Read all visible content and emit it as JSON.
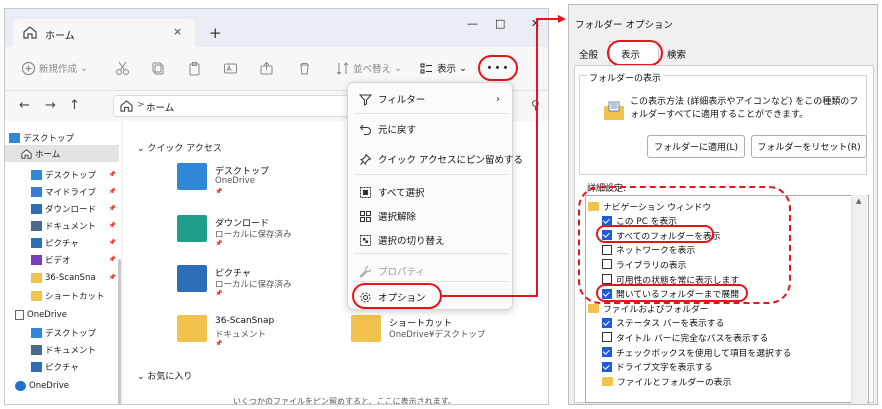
{
  "explorer": {
    "tab_label": "ホーム",
    "tab_close": "×",
    "new_tab": "+",
    "win_min": "—",
    "win_max": "□",
    "win_close": "✕",
    "toolbar": {
      "new_label": "新規作成",
      "sort_label": "並べ替え",
      "view_label": "表示",
      "more_label": "･･･"
    },
    "address": {
      "back": "←",
      "forward": "→",
      "up": "↑",
      "breadcrumb_chevron": ">",
      "path": "ホーム"
    },
    "sidebar": [
      {
        "label": "デスクトップ",
        "icon": "desktop-icon"
      },
      {
        "label": "ホーム",
        "icon": "home-icon",
        "selected": true
      },
      {
        "label": "デスクトップ",
        "icon": "desktop-icon",
        "pinned": true
      },
      {
        "label": "マイドライブ",
        "icon": "drive-icon",
        "pinned": true
      },
      {
        "label": "ダウンロード",
        "icon": "download-icon",
        "pinned": true
      },
      {
        "label": "ドキュメント",
        "icon": "document-icon",
        "pinned": true
      },
      {
        "label": "ピクチャ",
        "icon": "picture-icon",
        "pinned": true
      },
      {
        "label": "ビデオ",
        "icon": "video-icon",
        "pinned": true
      },
      {
        "label": "36-ScanSna",
        "icon": "folder-icon",
        "pinned": true
      },
      {
        "label": "ショートカット",
        "icon": "folder-icon"
      },
      {
        "label": "OneDrive",
        "icon": "onedrive-file-icon"
      },
      {
        "label": "デスクトップ",
        "icon": "desktop-icon"
      },
      {
        "label": "ドキュメント",
        "icon": "document-icon"
      },
      {
        "label": "ピクチャ",
        "icon": "picture-icon"
      },
      {
        "label": "OneDrive",
        "icon": "cloud-icon"
      }
    ],
    "quick_access_header": "クイック アクセス",
    "quick_items": [
      {
        "name": "デスクトップ",
        "sub": "OneDrive",
        "color": "#2f87d6"
      },
      {
        "name": "ダウンロード",
        "sub": "ローカルに保存済み",
        "color": "#1f9e8a"
      },
      {
        "name": "ピクチャ",
        "sub": "ローカルに保存済み",
        "color": "#2c6fb8"
      },
      {
        "name": "36-ScanSnap",
        "sub": "ドキュメント",
        "color": "#f2c24e"
      }
    ],
    "shortcut_item": {
      "name": "ショートカット",
      "sub": "OneDrive¥デスクトップ"
    },
    "favorites_header": "お気に入り",
    "bottom_message": "いくつかのファイルをピン留めすると、ここに表示されます。"
  },
  "menu": {
    "items": [
      {
        "label": "フィルター",
        "icon": "filter-icon",
        "arrow": "›"
      },
      {
        "label": "元に戻す",
        "icon": "undo-icon"
      },
      {
        "label": "クイック アクセスにピン留めする",
        "icon": "pin-icon"
      },
      {
        "label": "すべて選択",
        "icon": "select-all-icon"
      },
      {
        "label": "選択解除",
        "icon": "select-none-icon"
      },
      {
        "label": "選択の切り替え",
        "icon": "invert-selection-icon"
      },
      {
        "label": "プロパティ",
        "icon": "properties-icon",
        "disabled": true
      },
      {
        "label": "オプション",
        "icon": "gear-icon"
      }
    ]
  },
  "dialog": {
    "title": "フォルダー オプション",
    "tabs": [
      "全般",
      "表示",
      "検索"
    ],
    "active_tab": "表示",
    "folder_view_label": "フォルダーの表示",
    "folder_view_desc": "この表示方法 (詳細表示やアイコンなど) をこの種類のフォルダーすべてに適用することができます。",
    "apply_button": "フォルダーに適用(L)",
    "reset_button": "フォルダーをリセット(R)",
    "advanced_label": "詳細設定:",
    "settings": [
      {
        "label": "ナビゲーション ウィンドウ",
        "type": "folder",
        "indent": 0
      },
      {
        "label": "この PC を表示",
        "type": "checkbox",
        "checked": true,
        "indent": 1
      },
      {
        "label": "すべてのフォルダーを表示",
        "type": "checkbox",
        "checked": true,
        "indent": 1
      },
      {
        "label": "ネットワークを表示",
        "type": "checkbox",
        "checked": false,
        "indent": 1
      },
      {
        "label": "ライブラリの表示",
        "type": "checkbox",
        "checked": false,
        "indent": 1
      },
      {
        "label": "可用性の状態を常に表示します",
        "type": "checkbox",
        "checked": false,
        "indent": 1
      },
      {
        "label": "開いているフォルダーまで展開",
        "type": "checkbox",
        "checked": true,
        "indent": 1
      },
      {
        "label": "ファイルおよびフォルダー",
        "type": "folder",
        "indent": 0
      },
      {
        "label": "ステータス バーを表示する",
        "type": "checkbox",
        "checked": true,
        "indent": 1
      },
      {
        "label": "タイトル バーに完全なパスを表示する",
        "type": "checkbox",
        "checked": false,
        "indent": 1
      },
      {
        "label": "チェックボックスを使用して項目を選択する",
        "type": "checkbox",
        "checked": true,
        "indent": 1
      },
      {
        "label": "ドライブ文字を表示する",
        "type": "checkbox",
        "checked": true,
        "indent": 1
      },
      {
        "label": "ファイルとフォルダーの表示",
        "type": "folder",
        "indent": 1
      }
    ]
  },
  "colors": {
    "highlight_red": "#e8141c",
    "checkbox_blue": "#1e5bd6",
    "folder_yellow": "#f2c24e"
  }
}
